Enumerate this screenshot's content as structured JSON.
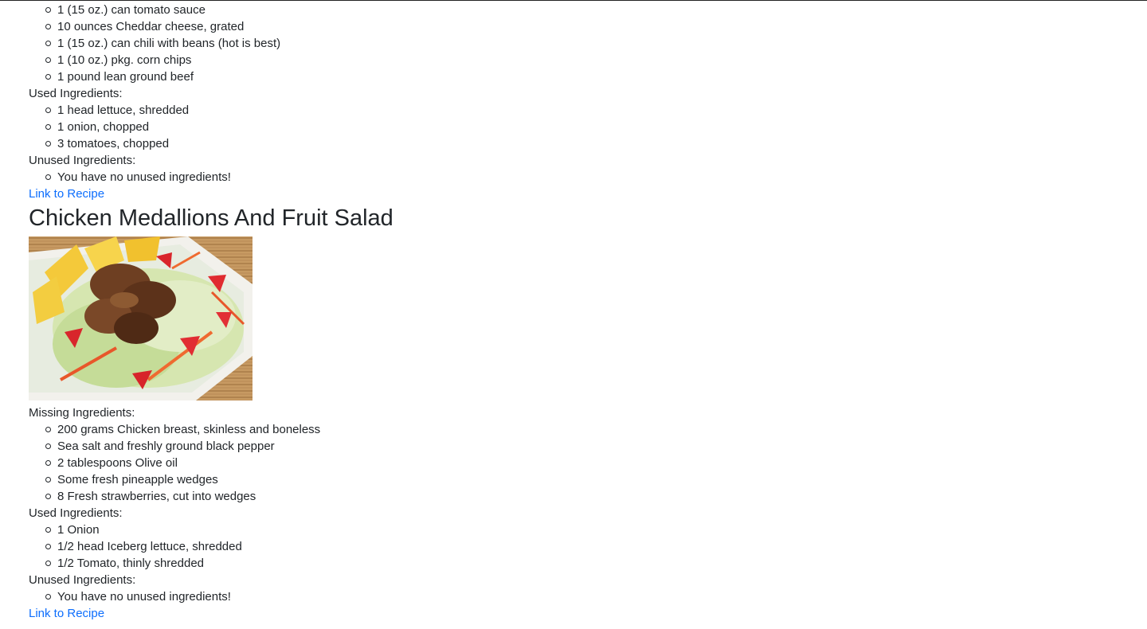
{
  "recipe_top": {
    "missing_tail": [
      "1 (15 oz.) can tomato sauce",
      "10 ounces Cheddar cheese, grated",
      "1 (15 oz.) can chili with beans (hot is best)",
      "1 (10 oz.) pkg. corn chips",
      "1 pound lean ground beef"
    ],
    "used_label": "Used Ingredients:",
    "used": [
      "1 head lettuce, shredded",
      "1 onion, chopped",
      "3 tomatoes, chopped"
    ],
    "unused_label": "Unused Ingredients:",
    "unused": [
      "You have no unused ingredients!"
    ],
    "link_label": "Link to Recipe"
  },
  "recipe_main": {
    "title": "Chicken Medallions And Fruit Salad",
    "image_icon": "food-photo",
    "missing_label": "Missing Ingredients:",
    "missing": [
      "200 grams Chicken breast, skinless and boneless",
      "Sea salt and freshly ground black pepper",
      "2 tablespoons Olive oil",
      "Some fresh pineapple wedges",
      "8 Fresh strawberries, cut into wedges"
    ],
    "used_label": "Used Ingredients:",
    "used": [
      "1 Onion",
      "1/2 head Iceberg lettuce, shredded",
      "1/2 Tomato, thinly shredded"
    ],
    "unused_label": "Unused Ingredients:",
    "unused": [
      "You have no unused ingredients!"
    ],
    "link_label": "Link to Recipe"
  },
  "colors": {
    "text": "#212529",
    "link": "#0d6efd",
    "background": "#ffffff"
  }
}
